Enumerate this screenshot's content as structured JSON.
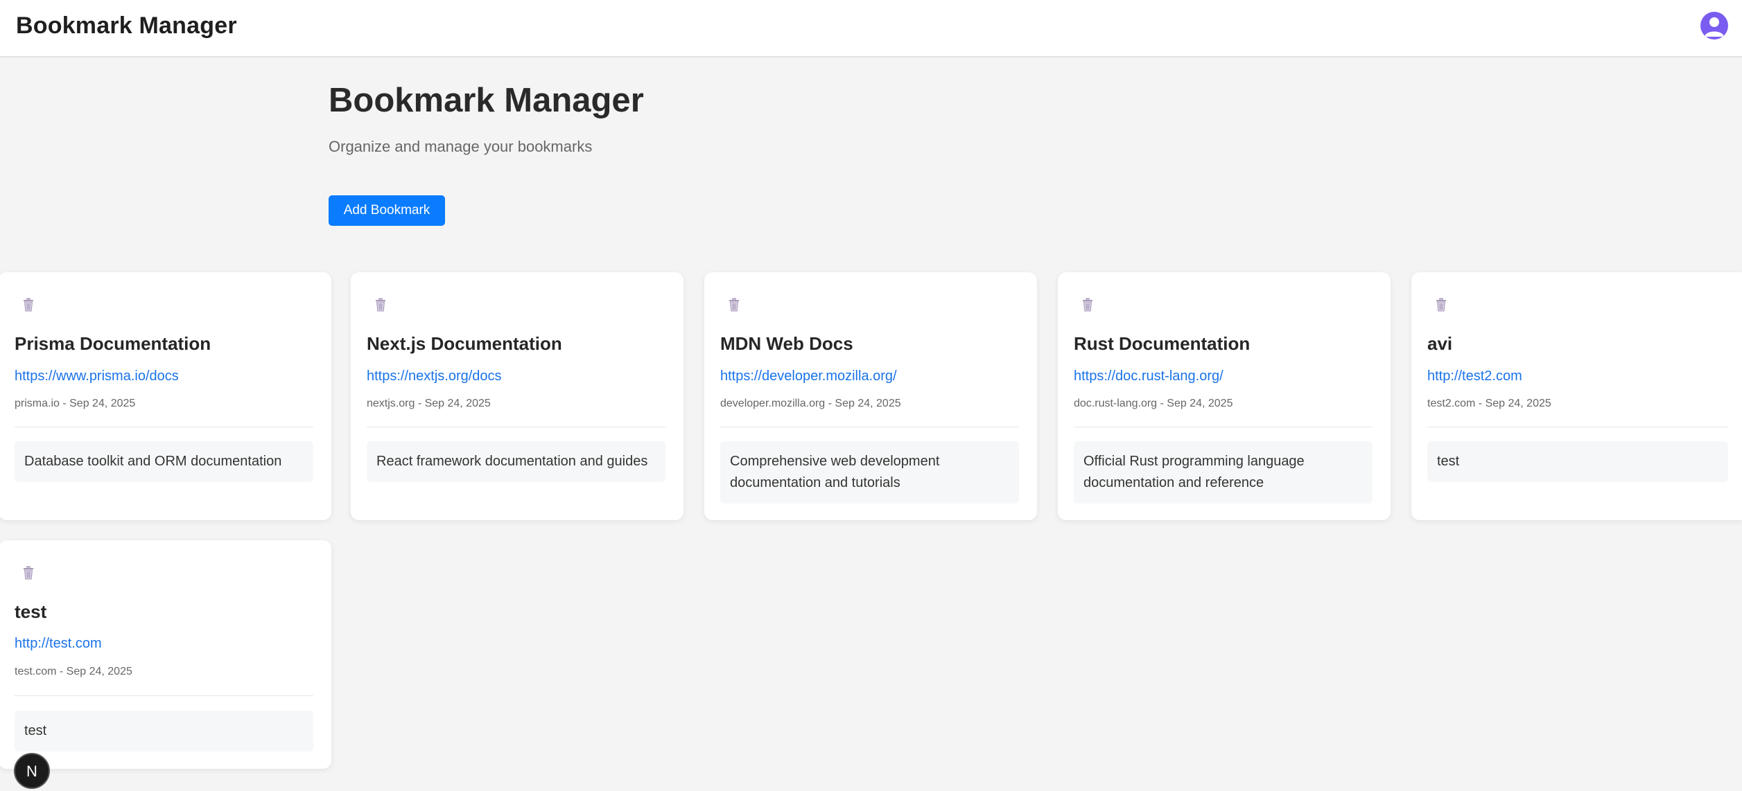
{
  "app": {
    "title": "Bookmark Manager",
    "avatar_icon": "user-avatar-icon",
    "accent_color": "#0a7cff",
    "avatar_color": "#7a5cf0"
  },
  "hero": {
    "title": "Bookmark Manager",
    "subtitle": "Organize and manage your bookmarks",
    "add_button_label": "Add Bookmark"
  },
  "bookmarks": [
    {
      "title": "Prisma Documentation",
      "url": "https://www.prisma.io/docs",
      "meta": "prisma.io - Sep 24, 2025",
      "description": "Database toolkit and ORM documentation",
      "icon": "trash-icon"
    },
    {
      "title": "Next.js Documentation",
      "url": "https://nextjs.org/docs",
      "meta": "nextjs.org - Sep 24, 2025",
      "description": "React framework documentation and guides",
      "icon": "trash-icon"
    },
    {
      "title": "MDN Web Docs",
      "url": "https://developer.mozilla.org/",
      "meta": "developer.mozilla.org - Sep 24, 2025",
      "description": "Comprehensive web development documentation and tutorials",
      "icon": "trash-icon"
    },
    {
      "title": "Rust Documentation",
      "url": "https://doc.rust-lang.org/",
      "meta": "doc.rust-lang.org - Sep 24, 2025",
      "description": "Official Rust programming language documentation and reference",
      "icon": "trash-icon"
    },
    {
      "title": "avi",
      "url": "http://test2.com",
      "meta": "test2.com - Sep 24, 2025",
      "description": "test",
      "icon": "trash-icon"
    },
    {
      "title": "test",
      "url": "http://test.com",
      "meta": "test.com - Sep 24, 2025",
      "description": "test",
      "icon": "trash-icon"
    }
  ],
  "dev_badge": {
    "label": "N",
    "icon": "nextjs-dev-indicator-icon"
  }
}
